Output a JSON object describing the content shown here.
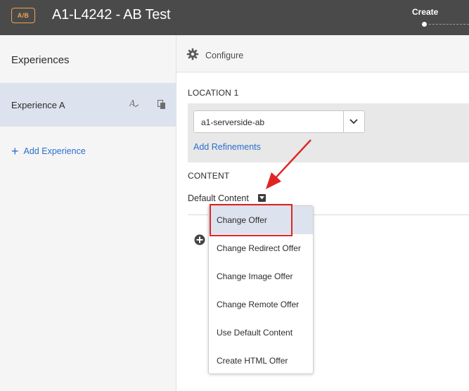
{
  "header": {
    "badge": "A/B",
    "title": "A1-L4242 - AB Test",
    "step": "Create"
  },
  "sidebar": {
    "heading": "Experiences",
    "experiences": [
      {
        "label": "Experience A",
        "rename_icon": "A",
        "selected": true
      }
    ],
    "add_label": "Add Experience"
  },
  "main": {
    "configure_label": "Configure",
    "location": {
      "label": "LOCATION 1",
      "value": "a1-serverside-ab",
      "refinements_link": "Add Refinements"
    },
    "content": {
      "label": "CONTENT",
      "default_label": "Default Content"
    }
  },
  "menu": {
    "items": [
      {
        "label": "Change Offer",
        "selected": true
      },
      {
        "label": "Change Redirect Offer"
      },
      {
        "label": "Change Image Offer"
      },
      {
        "label": "Change Remote Offer"
      },
      {
        "label": "Use Default Content"
      },
      {
        "label": "Create HTML Offer"
      }
    ]
  },
  "colors": {
    "header_bg": "#4a4a4a",
    "badge": "#f0a34a",
    "link": "#2d6ecd",
    "selected_bg": "#dde3ee",
    "annotation_red": "#e02424"
  }
}
